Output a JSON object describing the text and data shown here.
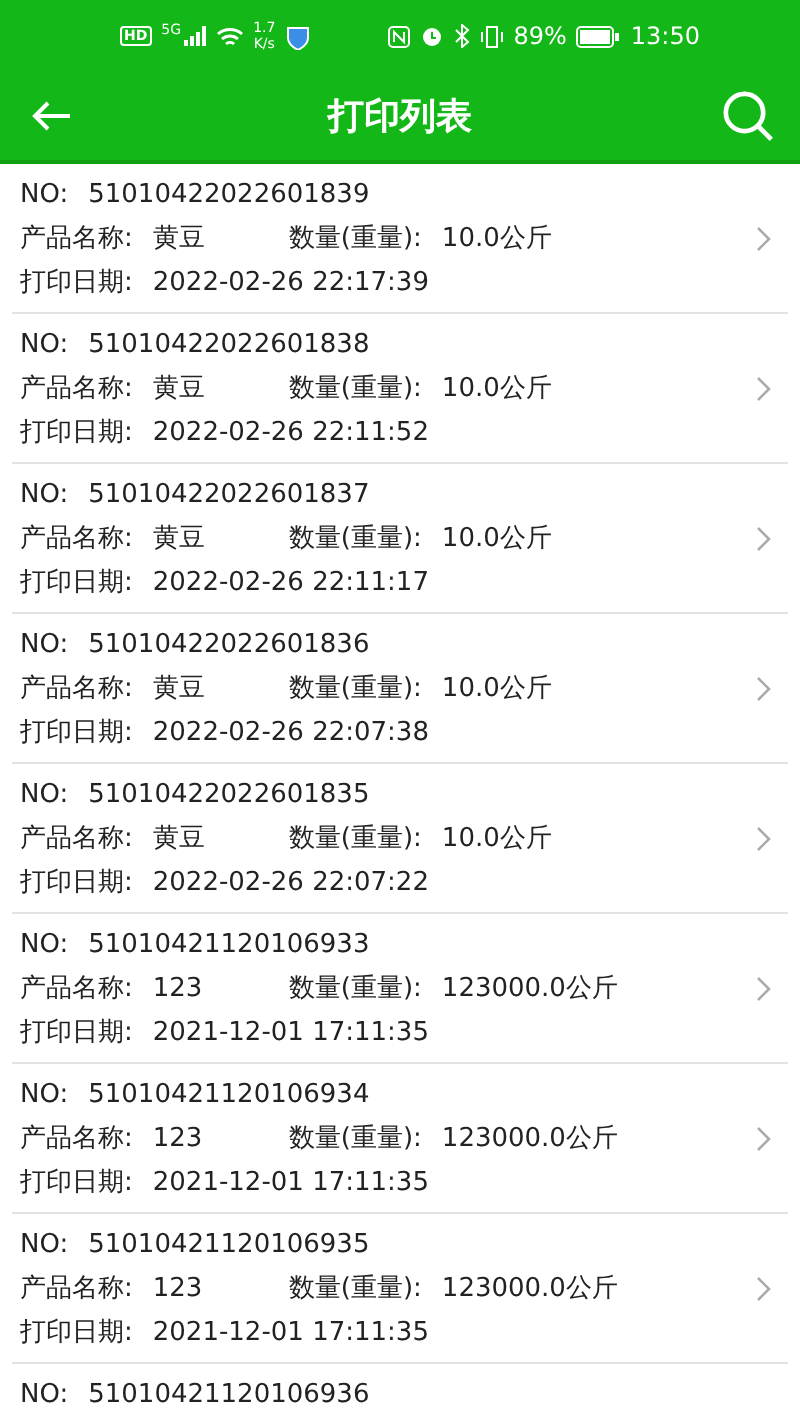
{
  "status_bar": {
    "hd": "HD",
    "network": "5G",
    "speed": "1.7",
    "speed_unit": "K/s",
    "battery": "89%",
    "time": "13:50"
  },
  "header": {
    "title": "打印列表"
  },
  "records": [
    {
      "no_label": "NO:",
      "no": "51010422022601839",
      "name_label": "产品名称:",
      "name": "黄豆",
      "qty_label": "数量(重量):",
      "qty": "10.0公斤",
      "date_label": "打印日期:",
      "date": "2022-02-26 22:17:39"
    },
    {
      "no_label": "NO:",
      "no": "51010422022601838",
      "name_label": "产品名称:",
      "name": "黄豆",
      "qty_label": "数量(重量):",
      "qty": "10.0公斤",
      "date_label": "打印日期:",
      "date": "2022-02-26 22:11:52"
    },
    {
      "no_label": "NO:",
      "no": "51010422022601837",
      "name_label": "产品名称:",
      "name": "黄豆",
      "qty_label": "数量(重量):",
      "qty": "10.0公斤",
      "date_label": "打印日期:",
      "date": "2022-02-26 22:11:17"
    },
    {
      "no_label": "NO:",
      "no": "51010422022601836",
      "name_label": "产品名称:",
      "name": "黄豆",
      "qty_label": "数量(重量):",
      "qty": "10.0公斤",
      "date_label": "打印日期:",
      "date": "2022-02-26 22:07:38"
    },
    {
      "no_label": "NO:",
      "no": "51010422022601835",
      "name_label": "产品名称:",
      "name": "黄豆",
      "qty_label": "数量(重量):",
      "qty": "10.0公斤",
      "date_label": "打印日期:",
      "date": "2022-02-26 22:07:22"
    },
    {
      "no_label": "NO:",
      "no": "51010421120106933",
      "name_label": "产品名称:",
      "name": "123",
      "qty_label": "数量(重量):",
      "qty": "123000.0公斤",
      "date_label": "打印日期:",
      "date": "2021-12-01 17:11:35"
    },
    {
      "no_label": "NO:",
      "no": "51010421120106934",
      "name_label": "产品名称:",
      "name": "123",
      "qty_label": "数量(重量):",
      "qty": "123000.0公斤",
      "date_label": "打印日期:",
      "date": "2021-12-01 17:11:35"
    },
    {
      "no_label": "NO:",
      "no": "51010421120106935",
      "name_label": "产品名称:",
      "name": "123",
      "qty_label": "数量(重量):",
      "qty": "123000.0公斤",
      "date_label": "打印日期:",
      "date": "2021-12-01 17:11:35"
    },
    {
      "no_label": "NO:",
      "no": "51010421120106936"
    }
  ]
}
